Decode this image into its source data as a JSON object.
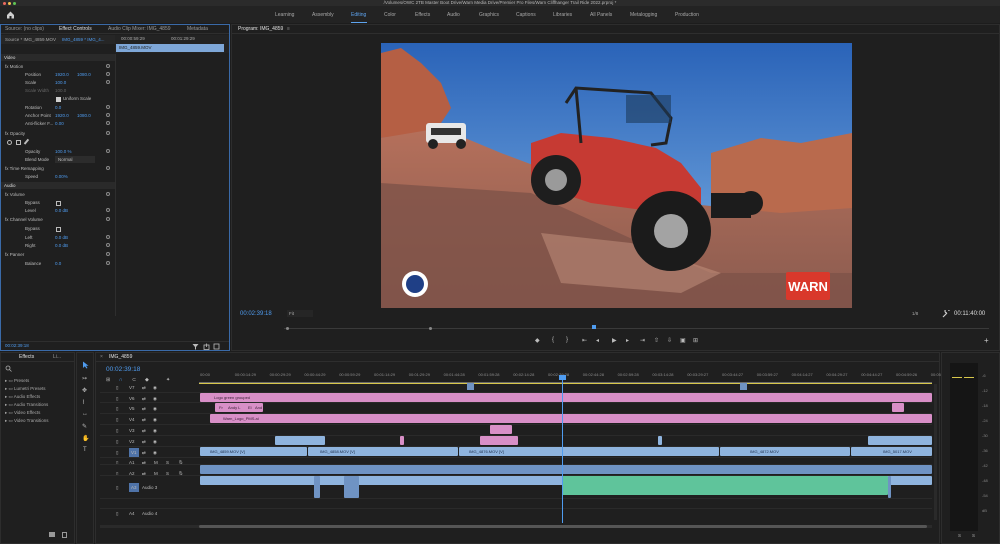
{
  "title_bar": "/Volumes/OWC 2TB Master Boot Drive/Warn Media Drive/Premier Pro Files/Warn Cliffhanger Trail Ride 2022.prproj *",
  "workspaces": [
    {
      "label": "Learning",
      "active": false
    },
    {
      "label": "Assembly",
      "active": false
    },
    {
      "label": "Editing",
      "active": true
    },
    {
      "label": "Color",
      "active": false
    },
    {
      "label": "Effects",
      "active": false
    },
    {
      "label": "Audio",
      "active": false
    },
    {
      "label": "Graphics",
      "active": false
    },
    {
      "label": "Captions",
      "active": false
    },
    {
      "label": "Libraries",
      "active": false
    },
    {
      "label": "All Panels",
      "active": false
    },
    {
      "label": "Metalogging",
      "active": false
    },
    {
      "label": "Production",
      "active": false
    }
  ],
  "source_tabs": [
    "Source: (no clips)",
    "Effect Controls",
    "Audio Clip Mixer: IMG_4859",
    "Metadata"
  ],
  "effect_controls": {
    "source_label": "Source * IMG_4859.MOV",
    "target_label": "IMG_4859 * IMG_4...",
    "timecode_start": "00:00:59:29",
    "timecode_end": "00:01:29:29",
    "clip_label": "IMG_4859.MOV",
    "current_timecode": "00:02:39:18",
    "rows": [
      {
        "label": "Video",
        "value": "",
        "value2": ""
      },
      {
        "label": "fx  Motion",
        "value": "",
        "value2": ""
      },
      {
        "label": "Position",
        "value": "1920.0",
        "value2": "1080.0"
      },
      {
        "label": "Scale",
        "value": "100.0",
        "value2": ""
      },
      {
        "label": "Scale Width",
        "value": "100.0",
        "value2": ""
      },
      {
        "label": "Uniform Scale",
        "value": "",
        "value2": ""
      },
      {
        "label": "Rotation",
        "value": "0.0",
        "value2": ""
      },
      {
        "label": "Anchor Point",
        "value": "1920.0",
        "value2": "1080.0"
      },
      {
        "label": "Anti-flicker F...",
        "value": "0.00",
        "value2": ""
      },
      {
        "label": "fx  Opacity",
        "value": "",
        "value2": ""
      },
      {
        "label": "",
        "value": "",
        "value2": ""
      },
      {
        "label": "Opacity",
        "value": "100.0 %",
        "value2": ""
      },
      {
        "label": "Blend Mode",
        "value": "Normal",
        "value2": ""
      },
      {
        "label": "fx  Time Remapping",
        "value": "",
        "value2": ""
      },
      {
        "label": "Speed",
        "value": "0.00%",
        "value2": ""
      },
      {
        "label": "Audio",
        "value": "",
        "value2": ""
      },
      {
        "label": "fx  Volume",
        "value": "",
        "value2": ""
      },
      {
        "label": "Bypass",
        "value": "",
        "value2": ""
      },
      {
        "label": "Level",
        "value": "0.0 dB",
        "value2": ""
      },
      {
        "label": "fx  Channel Volume",
        "value": "",
        "value2": ""
      },
      {
        "label": "Bypass",
        "value": "",
        "value2": ""
      },
      {
        "label": "Left",
        "value": "0.0 dB",
        "value2": ""
      },
      {
        "label": "Right",
        "value": "0.0 dB",
        "value2": ""
      },
      {
        "label": "fx  Panner",
        "value": "",
        "value2": ""
      },
      {
        "label": "Balance",
        "value": "0.0",
        "value2": ""
      }
    ]
  },
  "program": {
    "title": "Program: IMG_4859",
    "timecode": "00:02:39:18",
    "fit": "Fit",
    "resolution": "1/8",
    "duration": "00:11:40:00",
    "playhead_fraction": 0.437,
    "brand_logo": "WARN"
  },
  "effects_panel": {
    "tabs": [
      "Effects",
      "Li..."
    ],
    "items": [
      "Presets",
      "Lumetri Presets",
      "Audio Effects",
      "Audio Transitions",
      "Video Effects",
      "Video Transitions"
    ]
  },
  "timeline": {
    "sequence": "IMG_4859",
    "timecode": "00:02:39:18",
    "ruler": [
      "00:00",
      "00:00:14:29",
      "00:00:29:29",
      "00:00:44:29",
      "00:00:59:29",
      "00:01:14:29",
      "00:01:29:29",
      "00:01:44:28",
      "00:01:59:28",
      "00:02:14:28",
      "00:02:29:28",
      "00:02:44:28",
      "00:02:59:28",
      "00:03:14:28",
      "00:03:29:27",
      "00:03:44:27",
      "00:03:59:27",
      "00:04:14:27",
      "00:04:29:27",
      "00:04:44:27",
      "00:04:59:26",
      "00:05:14:26"
    ],
    "video_tracks": [
      "V7",
      "V6",
      "V5",
      "V4",
      "V3",
      "V2",
      "V1"
    ],
    "audio_tracks": [
      "A1",
      "A2",
      "A3",
      "A4"
    ],
    "audio_names": {
      "A3": "Audio 3",
      "A4": "Audio 4"
    },
    "clip_labels": {
      "logo": "Logo green grouped",
      "t1": "Fr",
      "t2": "Andy L",
      "t3": "El",
      "t4": "And",
      "warn_logo": "Warn_Logo_PMS.ai",
      "v1a": "IMG_4859.MOV [V]",
      "v1b": "IMG_4858.MOV [V]",
      "v1c": "IMG_4876.MOV [V]",
      "v1d": "IMG_4872.MOV",
      "v1e": "IMG_5017.MOV"
    }
  },
  "meter_scale": [
    "-6",
    "-12",
    "-18",
    "-24",
    "-30",
    "-36",
    "-42",
    "-48",
    "-54",
    "dB"
  ],
  "meter_foot": [
    "S",
    "S"
  ]
}
